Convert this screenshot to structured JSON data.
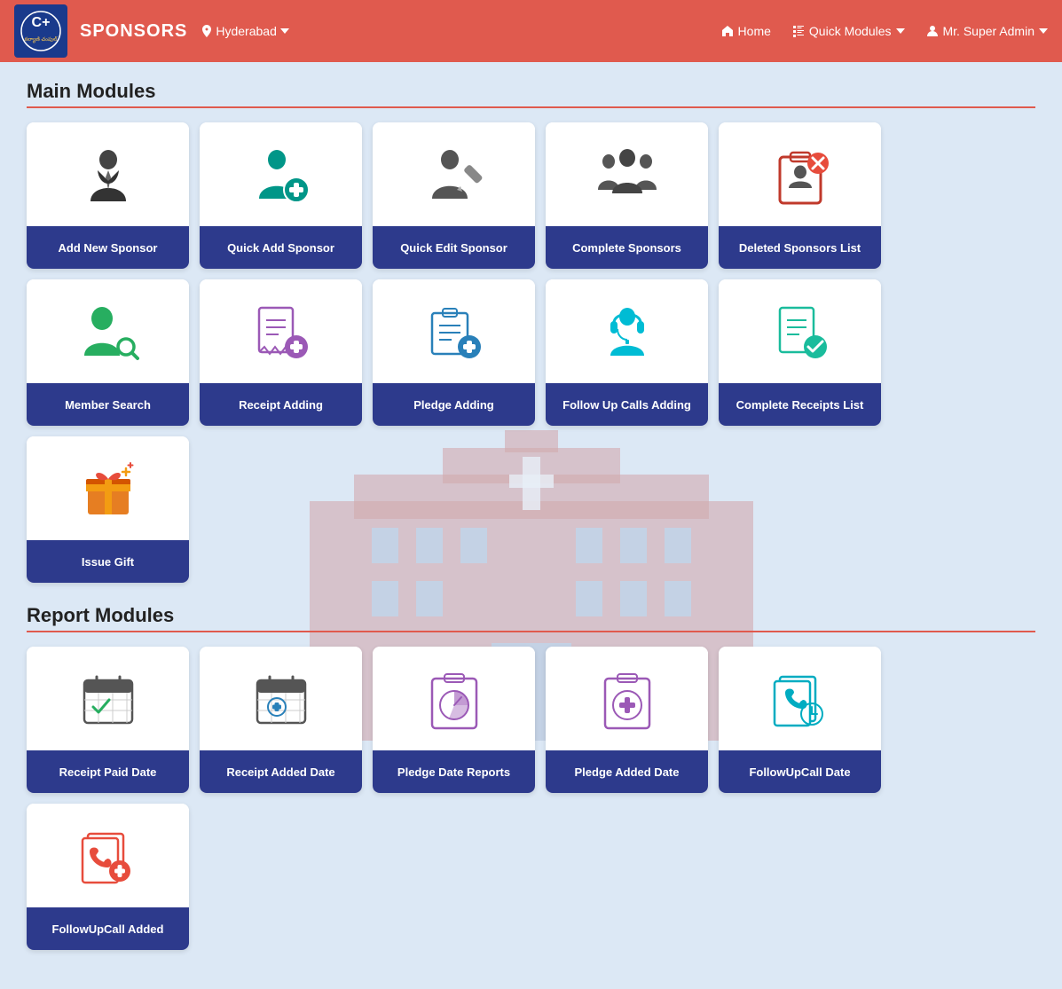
{
  "header": {
    "title": "SPONSORS",
    "location": "Hyderabad",
    "nav": {
      "home": "Home",
      "quick_modules": "Quick Modules",
      "user": "Mr. Super Admin"
    }
  },
  "main_modules": {
    "section_title": "Main Modules",
    "cards": [
      {
        "id": "add-new-sponsor",
        "label": "Add New Sponsor",
        "icon": "person-add"
      },
      {
        "id": "quick-add-sponsor",
        "label": "Quick Add Sponsor",
        "icon": "person-plus-teal"
      },
      {
        "id": "quick-edit-sponsor",
        "label": "Quick Edit Sponsor",
        "icon": "person-edit"
      },
      {
        "id": "complete-sponsors",
        "label": "Complete Sponsors",
        "icon": "group"
      },
      {
        "id": "deleted-sponsors-list",
        "label": "Deleted Sponsors List",
        "icon": "clipboard-x"
      },
      {
        "id": "member-search",
        "label": "Member Search",
        "icon": "person-search"
      },
      {
        "id": "receipt-adding",
        "label": "Receipt Adding",
        "icon": "receipt-add"
      },
      {
        "id": "pledge-adding",
        "label": "Pledge Adding",
        "icon": "pledge-add"
      },
      {
        "id": "follow-up-calls-adding",
        "label": "Follow Up Calls Adding",
        "icon": "headset"
      },
      {
        "id": "complete-receipts-list",
        "label": "Complete Receipts List",
        "icon": "receipt-check"
      },
      {
        "id": "issue-gift",
        "label": "Issue Gift",
        "icon": "gift"
      }
    ]
  },
  "report_modules": {
    "section_title": "Report Modules",
    "cards": [
      {
        "id": "receipt-paid-date",
        "label": "Receipt Paid Date",
        "icon": "cal-check"
      },
      {
        "id": "receipt-added-date",
        "label": "Receipt Added Date",
        "icon": "cal-plus"
      },
      {
        "id": "pledge-date-reports",
        "label": "Pledge Date Reports",
        "icon": "clipboard-chart"
      },
      {
        "id": "pledge-added-date",
        "label": "Pledge Added Date",
        "icon": "clipboard-plus"
      },
      {
        "id": "followupcall-date",
        "label": "FollowUpCall Date",
        "icon": "pages-phone"
      },
      {
        "id": "followupcall-added",
        "label": "FollowUpCall Added",
        "icon": "pages-phone2"
      }
    ]
  }
}
